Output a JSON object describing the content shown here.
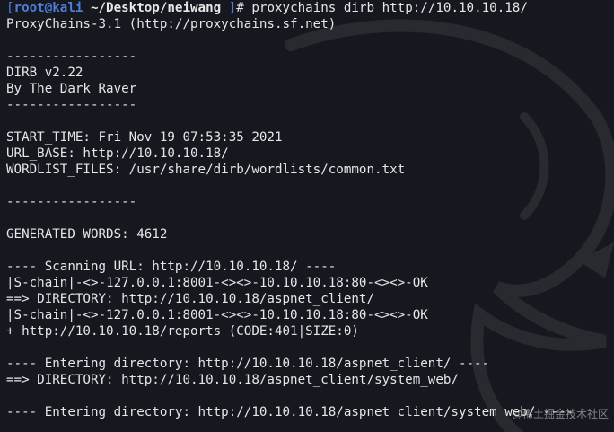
{
  "prompt": {
    "open_bracket": "[",
    "user_host": "root@kali",
    "path": "~/Desktop/neiwang",
    "close_bracket": " ]",
    "symbol": "# ",
    "command": "proxychains dirb http://10.10.10.18/"
  },
  "output": {
    "proxychains_banner": "ProxyChains-3.1 (http://proxychains.sf.net)",
    "sep1": "-----------------",
    "dirb_version": "DIRB v2.22",
    "dirb_author": "By The Dark Raver",
    "sep2": "-----------------",
    "start_time": "START_TIME: Fri Nov 19 07:53:35 2021",
    "url_base": "URL_BASE: http://10.10.10.18/",
    "wordlist": "WORDLIST_FILES: /usr/share/dirb/wordlists/common.txt",
    "sep3": "-----------------",
    "generated": "GENERATED WORDS: 4612",
    "scan_header": "---- Scanning URL: http://10.10.10.18/ ----",
    "chain1": "|S-chain|-<>-127.0.0.1:8001-<><>-10.10.10.18:80-<><>-OK",
    "dir1": "==> DIRECTORY: http://10.10.10.18/aspnet_client/",
    "chain2": "|S-chain|-<>-127.0.0.1:8001-<><>-10.10.10.18:80-<><>-OK",
    "found1": "+ http://10.10.10.18/reports (CODE:401|SIZE:0)",
    "enter1": "---- Entering directory: http://10.10.10.18/aspnet_client/ ----",
    "dir2": "==> DIRECTORY: http://10.10.10.18/aspnet_client/system_web/",
    "enter2": "---- Entering directory: http://10.10.10.18/aspnet_client/system_web/ ----"
  },
  "watermark": "@稀土掘金技术社区",
  "colors": {
    "background": "#15181e",
    "prompt_blue": "#4e7ed8",
    "text": "#e6e6e6"
  }
}
